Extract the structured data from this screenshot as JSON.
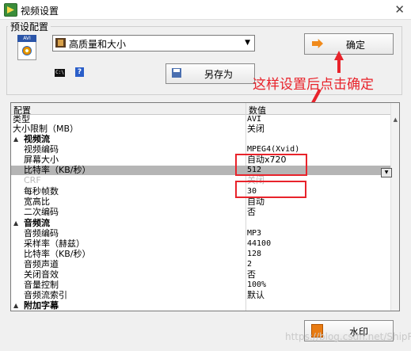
{
  "window": {
    "title": "视频设置",
    "close_glyph": "✕"
  },
  "preset": {
    "group_label": "预设配置",
    "icon_label": "AVI",
    "selected": "高质量和大小",
    "ok_button": "确定",
    "saveas_button": "另存为",
    "cmd_icon_text": "C:\\",
    "help_icon_text": "?"
  },
  "annotation": {
    "text": "这样设置后点击确定",
    "color": "#e8232b"
  },
  "grid": {
    "col_name": "配置",
    "col_value": "数值",
    "rows": [
      {
        "name": "类型",
        "value": "AVI"
      },
      {
        "name": "大小限制（MB）",
        "value": "关闭"
      },
      {
        "name": "视频流",
        "value": ""
      },
      {
        "name": "视频编码",
        "value": "MPEG4(Xvid)"
      },
      {
        "name": "屏幕大小",
        "value": "自动x720"
      },
      {
        "name": "比特率（KB/秒）",
        "value": "512"
      },
      {
        "name": "CRF",
        "value": "关闭"
      },
      {
        "name": "每秒帧数",
        "value": "30"
      },
      {
        "name": "宽高比",
        "value": "自动"
      },
      {
        "name": "二次编码",
        "value": "否"
      },
      {
        "name": "音频流",
        "value": ""
      },
      {
        "name": "音频编码",
        "value": "MP3"
      },
      {
        "name": "采样率（赫兹）",
        "value": "44100"
      },
      {
        "name": "比特率（KB/秒）",
        "value": "128"
      },
      {
        "name": "音频声道",
        "value": "2"
      },
      {
        "name": "关闭音效",
        "value": "否"
      },
      {
        "name": "音量控制",
        "value": "100%"
      },
      {
        "name": "音频流索引",
        "value": "默认"
      },
      {
        "name": "附加字幕",
        "value": ""
      }
    ]
  },
  "watermark_button": "水印",
  "page_watermark": "https://blog.csdn.net/ShipRun"
}
